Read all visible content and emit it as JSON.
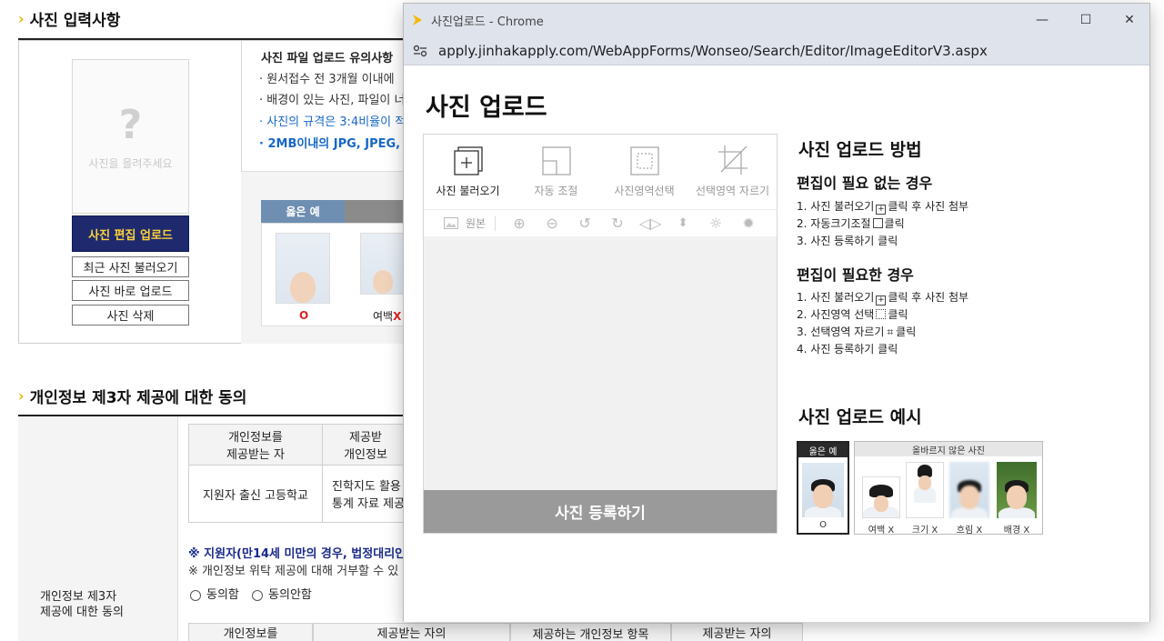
{
  "background": {
    "section1_title": "사진 입력사항",
    "photo_placeholder": "사진을 올려주세요",
    "photo_buttons": [
      "사진 편집 업로드",
      "최근 사진 불러오기",
      "사진 바로 업로드",
      "사진 삭제"
    ],
    "notice_title": "사진 파일 업로드 유의사항",
    "notice_lines": [
      "원서접수 전 3개월 이내에",
      "배경이 있는 사진, 파일이 너",
      "사진의 규격은 3:4비율이 적",
      "2MB이내의 JPG, JPEG,"
    ],
    "example_good": "옳은 예",
    "example_good_mark": "O",
    "example_bad_caption": "여백",
    "example_bad_mark": "X",
    "section2_title": "개인정보 제3자 제공에 대한 동의",
    "consent_left_label": "개인정보 제3자\n제공에 대한 동의",
    "table_headers": [
      "개인정보를\n제공받는 자",
      "제공받\n개인정보"
    ],
    "table_row": [
      "지원자 출신 고등학교",
      "진학지도 활용\n통계 자료 제공"
    ],
    "note1": "※ 지원자(만14세 미만의 경우, 법정대리인",
    "note2": "※ 개인정보 위탁 제공에 대해 거부할 수 있",
    "radio_agree": "동의함",
    "radio_disagree": "동의안함",
    "bottom_headers": [
      "개인정보를",
      "제공받는 자의",
      "제공하는 개인정보 항목",
      "제공받는 자의"
    ]
  },
  "window": {
    "title": "사진업로드 - Chrome",
    "url": "apply.jinhakapply.com/WebAppForms/Wonseo/Search/Editor/ImageEditorV3.aspx",
    "controls": [
      "minimize",
      "maximize",
      "close"
    ]
  },
  "editor": {
    "page_title": "사진 업로드",
    "tools": [
      "사진 불러오기",
      "자동 조절",
      "사진영역선택",
      "선택영역 자르기"
    ],
    "original_label": "원본",
    "register_button": "사진 등록하기"
  },
  "help": {
    "title": "사진 업로드 방법",
    "no_edit_title": "편집이 필요 없는 경우",
    "no_edit_steps": [
      {
        "num": "1.",
        "before": "사진 불러오기",
        "after": "클릭 후 사진 첨부"
      },
      {
        "num": "2.",
        "before": "자동크기조절",
        "after": "클릭"
      },
      {
        "num": "3.",
        "before": "사진 등록하기 클릭",
        "after": ""
      }
    ],
    "edit_title": "편집이 필요한 경우",
    "edit_steps": [
      {
        "num": "1.",
        "before": "사진 불러오기",
        "after": "클릭 후 사진 첨부"
      },
      {
        "num": "2.",
        "before": "사진영역 선택",
        "after": "클릭"
      },
      {
        "num": "3.",
        "before": "선택영역 자르기",
        "after": "클릭"
      },
      {
        "num": "4.",
        "before": "사진 등록하기 클릭",
        "after": ""
      }
    ],
    "example_title": "사진 업로드 예시",
    "good_label": "옳은 예",
    "good_caption": "O",
    "bad_label": "올바르지 않은 사진",
    "bad_captions": [
      "여백 X",
      "크기 X",
      "흐림 X",
      "배경 X"
    ]
  }
}
